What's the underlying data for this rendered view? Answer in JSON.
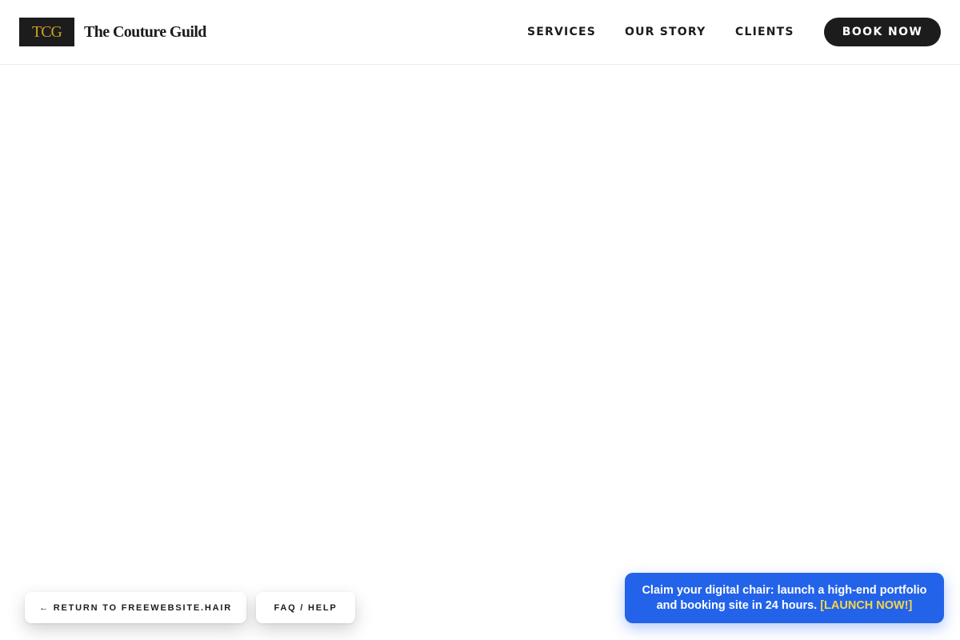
{
  "header": {
    "logo_mark": "TCG",
    "brand_name": "The Couture Guild",
    "nav": {
      "services": "SERVICES",
      "our_story": "OUR STORY",
      "clients": "CLIENTS"
    },
    "book_now": "BOOK NOW"
  },
  "floating": {
    "return_label": "← RETURN TO FREEWEBSITE.HAIR",
    "faq_label": "FAQ / HELP"
  },
  "promo": {
    "line1": "Claim your digital chair: launch a high-end portfolio",
    "line2": "and booking site in 24 hours.",
    "cta": "[LAUNCH NOW!]"
  },
  "colors": {
    "dark": "#1c1c1c",
    "gold": "#c9a227",
    "promo_blue": "#2363ea",
    "promo_cta": "#f5d54a"
  }
}
